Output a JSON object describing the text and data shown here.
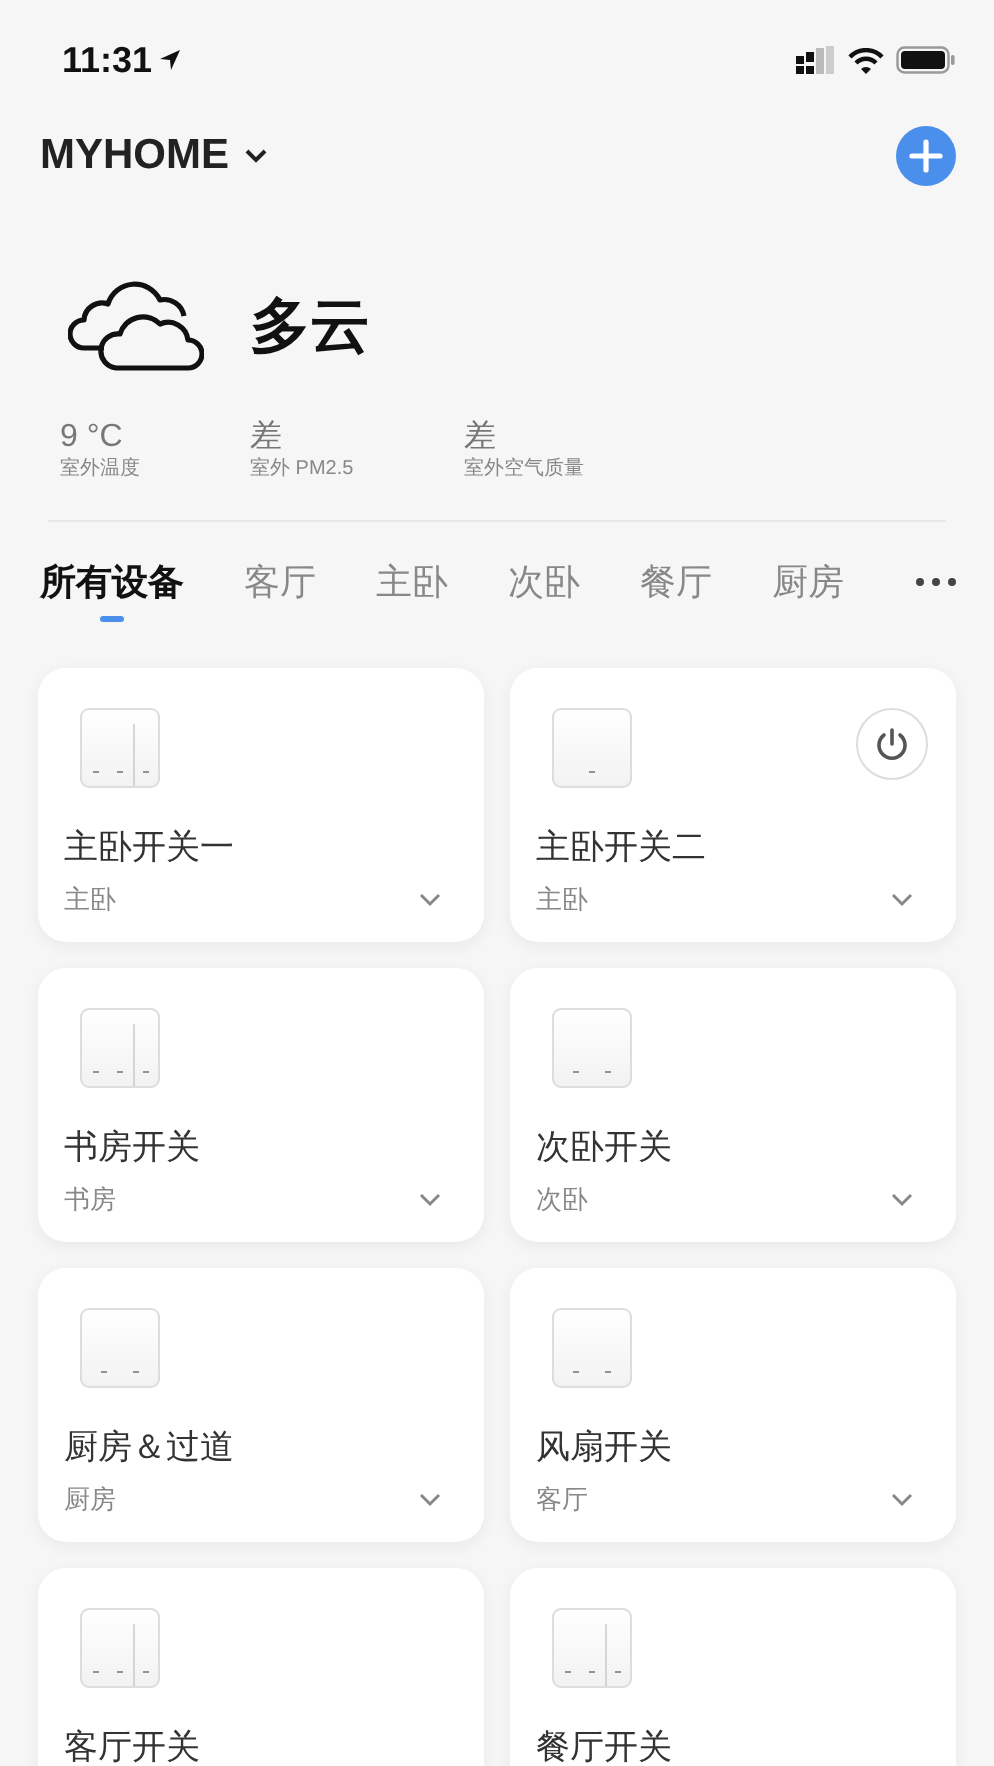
{
  "status_bar": {
    "time": "11:31"
  },
  "header": {
    "home": "MYHOME"
  },
  "weather": {
    "condition": "多云",
    "stats": [
      {
        "value": "9 °C",
        "label": "室外温度"
      },
      {
        "value": "差",
        "label": "室外 PM2.5"
      },
      {
        "value": "差",
        "label": "室外空气质量"
      }
    ]
  },
  "tabs": [
    {
      "label": "所有设备",
      "selected": true
    },
    {
      "label": "客厅",
      "selected": false
    },
    {
      "label": "主卧",
      "selected": false
    },
    {
      "label": "次卧",
      "selected": false
    },
    {
      "label": "餐厅",
      "selected": false
    },
    {
      "label": "厨房",
      "selected": false
    }
  ],
  "devices": [
    {
      "name": "主卧开关一",
      "room": "主卧",
      "kind": "triple",
      "power_button": false
    },
    {
      "name": "主卧开关二",
      "room": "主卧",
      "kind": "single",
      "power_button": true
    },
    {
      "name": "书房开关",
      "room": "书房",
      "kind": "triple",
      "power_button": false
    },
    {
      "name": "次卧开关",
      "room": "次卧",
      "kind": "double",
      "power_button": false
    },
    {
      "name": "厨房＆过道",
      "room": "厨房",
      "kind": "double",
      "power_button": false
    },
    {
      "name": "风扇开关",
      "room": "客厅",
      "kind": "double",
      "power_button": false
    },
    {
      "name": "客厅开关",
      "kind": "triple",
      "power_button": false
    },
    {
      "name": "餐厅开关",
      "kind": "triple",
      "power_button": false
    }
  ]
}
